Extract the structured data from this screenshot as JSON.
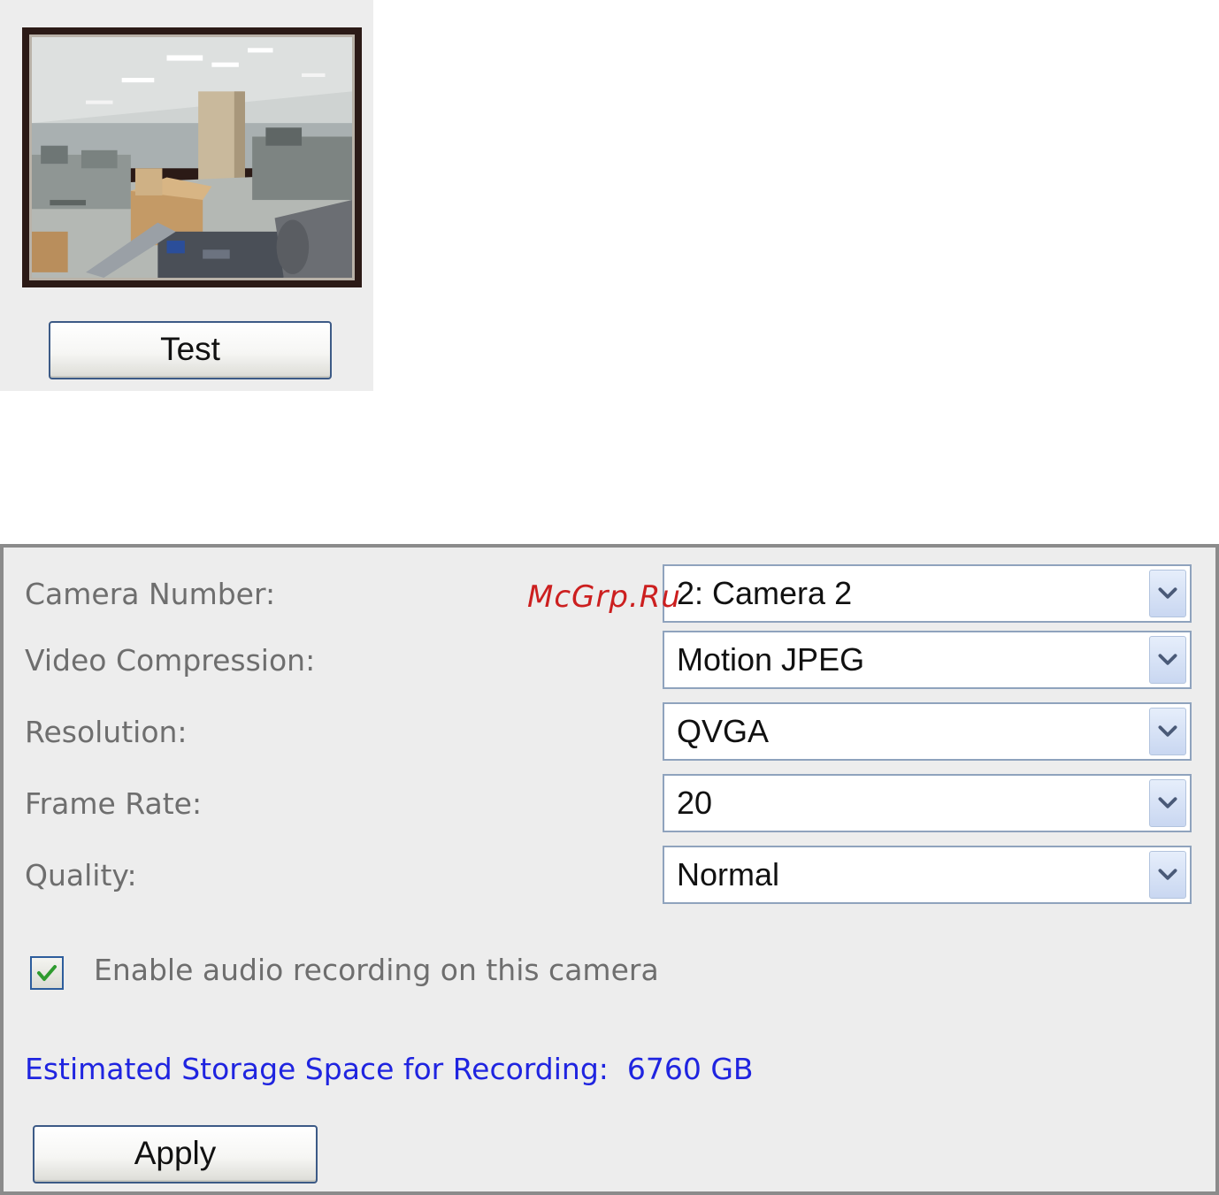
{
  "preview": {
    "test_button_label": "Test"
  },
  "settings": {
    "fields": [
      {
        "label": "Camera Number:",
        "value": "2: Camera 2"
      },
      {
        "label": "Video Compression:",
        "value": "Motion JPEG"
      },
      {
        "label": "Resolution:",
        "value": "QVGA"
      },
      {
        "label": "Frame Rate:",
        "value": "20"
      },
      {
        "label": "Quality:",
        "value": "Normal"
      }
    ],
    "audio": {
      "label": "Enable audio recording on this camera",
      "checked": true
    },
    "storage": {
      "label": "Estimated Storage Space for Recording:",
      "value": "6760 GB"
    },
    "apply_button_label": "Apply"
  },
  "watermark": "McGrp.Ru",
  "colors": {
    "panel_background": "#ededed",
    "panel_border": "#8b8b8b",
    "label_text": "#6e6e6e",
    "storage_text": "#1f24e0",
    "button_border": "#3c5a86",
    "select_border": "#8fa3bd",
    "checkmark": "#2e9b2e",
    "watermark": "#cc1f1f"
  },
  "icons": {
    "dropdown": "chevron-down-icon",
    "checkbox": "check-icon"
  }
}
